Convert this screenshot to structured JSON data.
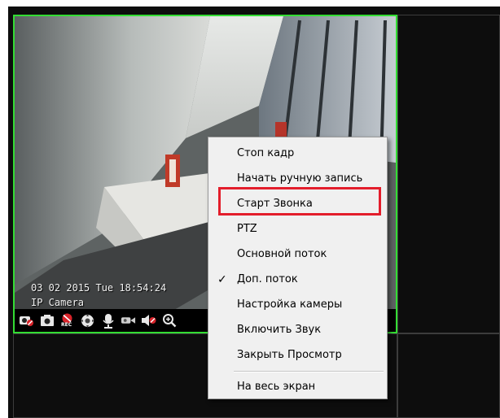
{
  "camera": {
    "osd_datetime": "03 02 2015 Tue 18:54:24",
    "osd_name": "IP Camera"
  },
  "toolbar": {
    "icons": [
      "camera-toggle-icon",
      "snapshot-icon",
      "record-icon",
      "ptz-icon",
      "talk-icon",
      "camera-settings-icon",
      "audio-icon",
      "zoom-icon"
    ],
    "record_badge": "REC"
  },
  "context_menu": {
    "items": [
      {
        "label": "Стоп кадр",
        "checked": false
      },
      {
        "label": "Начать ручную запись",
        "checked": false
      },
      {
        "label": "Старт Звонка",
        "checked": false,
        "highlighted": true
      },
      {
        "label": "PTZ",
        "checked": false
      },
      {
        "label": "Основной поток",
        "checked": false
      },
      {
        "label": "Доп. поток",
        "checked": true
      },
      {
        "label": "Настройка камеры",
        "checked": false
      },
      {
        "label": "Включить Звук",
        "checked": false
      },
      {
        "label": "Закрыть Просмотр",
        "checked": false
      },
      {
        "label": "На весь экран",
        "checked": false
      }
    ],
    "check_mark": "✓"
  },
  "colors": {
    "active_border": "#33dd33",
    "highlight": "#e31d2b",
    "record_red": "#d8232a"
  }
}
